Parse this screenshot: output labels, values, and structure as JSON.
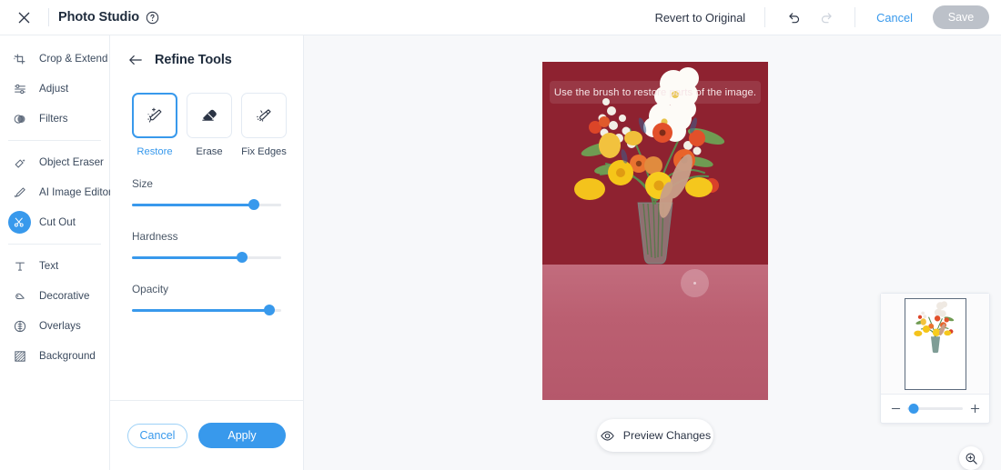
{
  "header": {
    "close_icon": "close-icon",
    "title": "Photo Studio",
    "help_icon": "help-circle-icon",
    "revert_label": "Revert to Original",
    "undo_icon": "undo-icon",
    "redo_icon": "redo-icon",
    "cancel_label": "Cancel",
    "save_label": "Save"
  },
  "sidebar": {
    "items": [
      {
        "label": "Crop & Extend",
        "icon": "crop-icon",
        "active": false
      },
      {
        "label": "Adjust",
        "icon": "sliders-icon",
        "active": false
      },
      {
        "label": "Filters",
        "icon": "filters-icon",
        "active": false
      },
      {
        "label": "Object Eraser",
        "icon": "object-eraser-icon",
        "active": false
      },
      {
        "label": "AI Image Editor",
        "icon": "ai-brush-icon",
        "active": false
      },
      {
        "label": "Cut Out",
        "icon": "cut-out-icon",
        "active": true
      },
      {
        "label": "Text",
        "icon": "text-icon",
        "active": false
      },
      {
        "label": "Decorative",
        "icon": "decorative-icon",
        "active": false
      },
      {
        "label": "Overlays",
        "icon": "overlays-icon",
        "active": false
      },
      {
        "label": "Background",
        "icon": "background-icon",
        "active": false
      }
    ]
  },
  "panel": {
    "back_icon": "arrow-left-icon",
    "title": "Refine Tools",
    "tools": [
      {
        "label": "Restore",
        "icon": "restore-brush-icon",
        "selected": true
      },
      {
        "label": "Erase",
        "icon": "eraser-icon",
        "selected": false
      },
      {
        "label": "Fix Edges",
        "icon": "fix-edges-brush-icon",
        "selected": false
      }
    ],
    "sliders": [
      {
        "label": "Size",
        "value": 82
      },
      {
        "label": "Hardness",
        "value": 74
      },
      {
        "label": "Opacity",
        "value": 92
      }
    ],
    "cancel_label": "Cancel",
    "apply_label": "Apply"
  },
  "canvas": {
    "hint_text": "Use the brush to restore parts of the image.",
    "preview_label": "Preview Changes",
    "preview_icon": "eye-icon",
    "colors": {
      "wall": "#8E2230",
      "table": "#BD6072",
      "accent": "#3899EC"
    }
  },
  "minimap": {
    "zoom_out_icon": "minus-icon",
    "zoom_in_icon": "plus-icon",
    "zoom_value": 12,
    "fit_icon": "zoom-fit-icon"
  }
}
